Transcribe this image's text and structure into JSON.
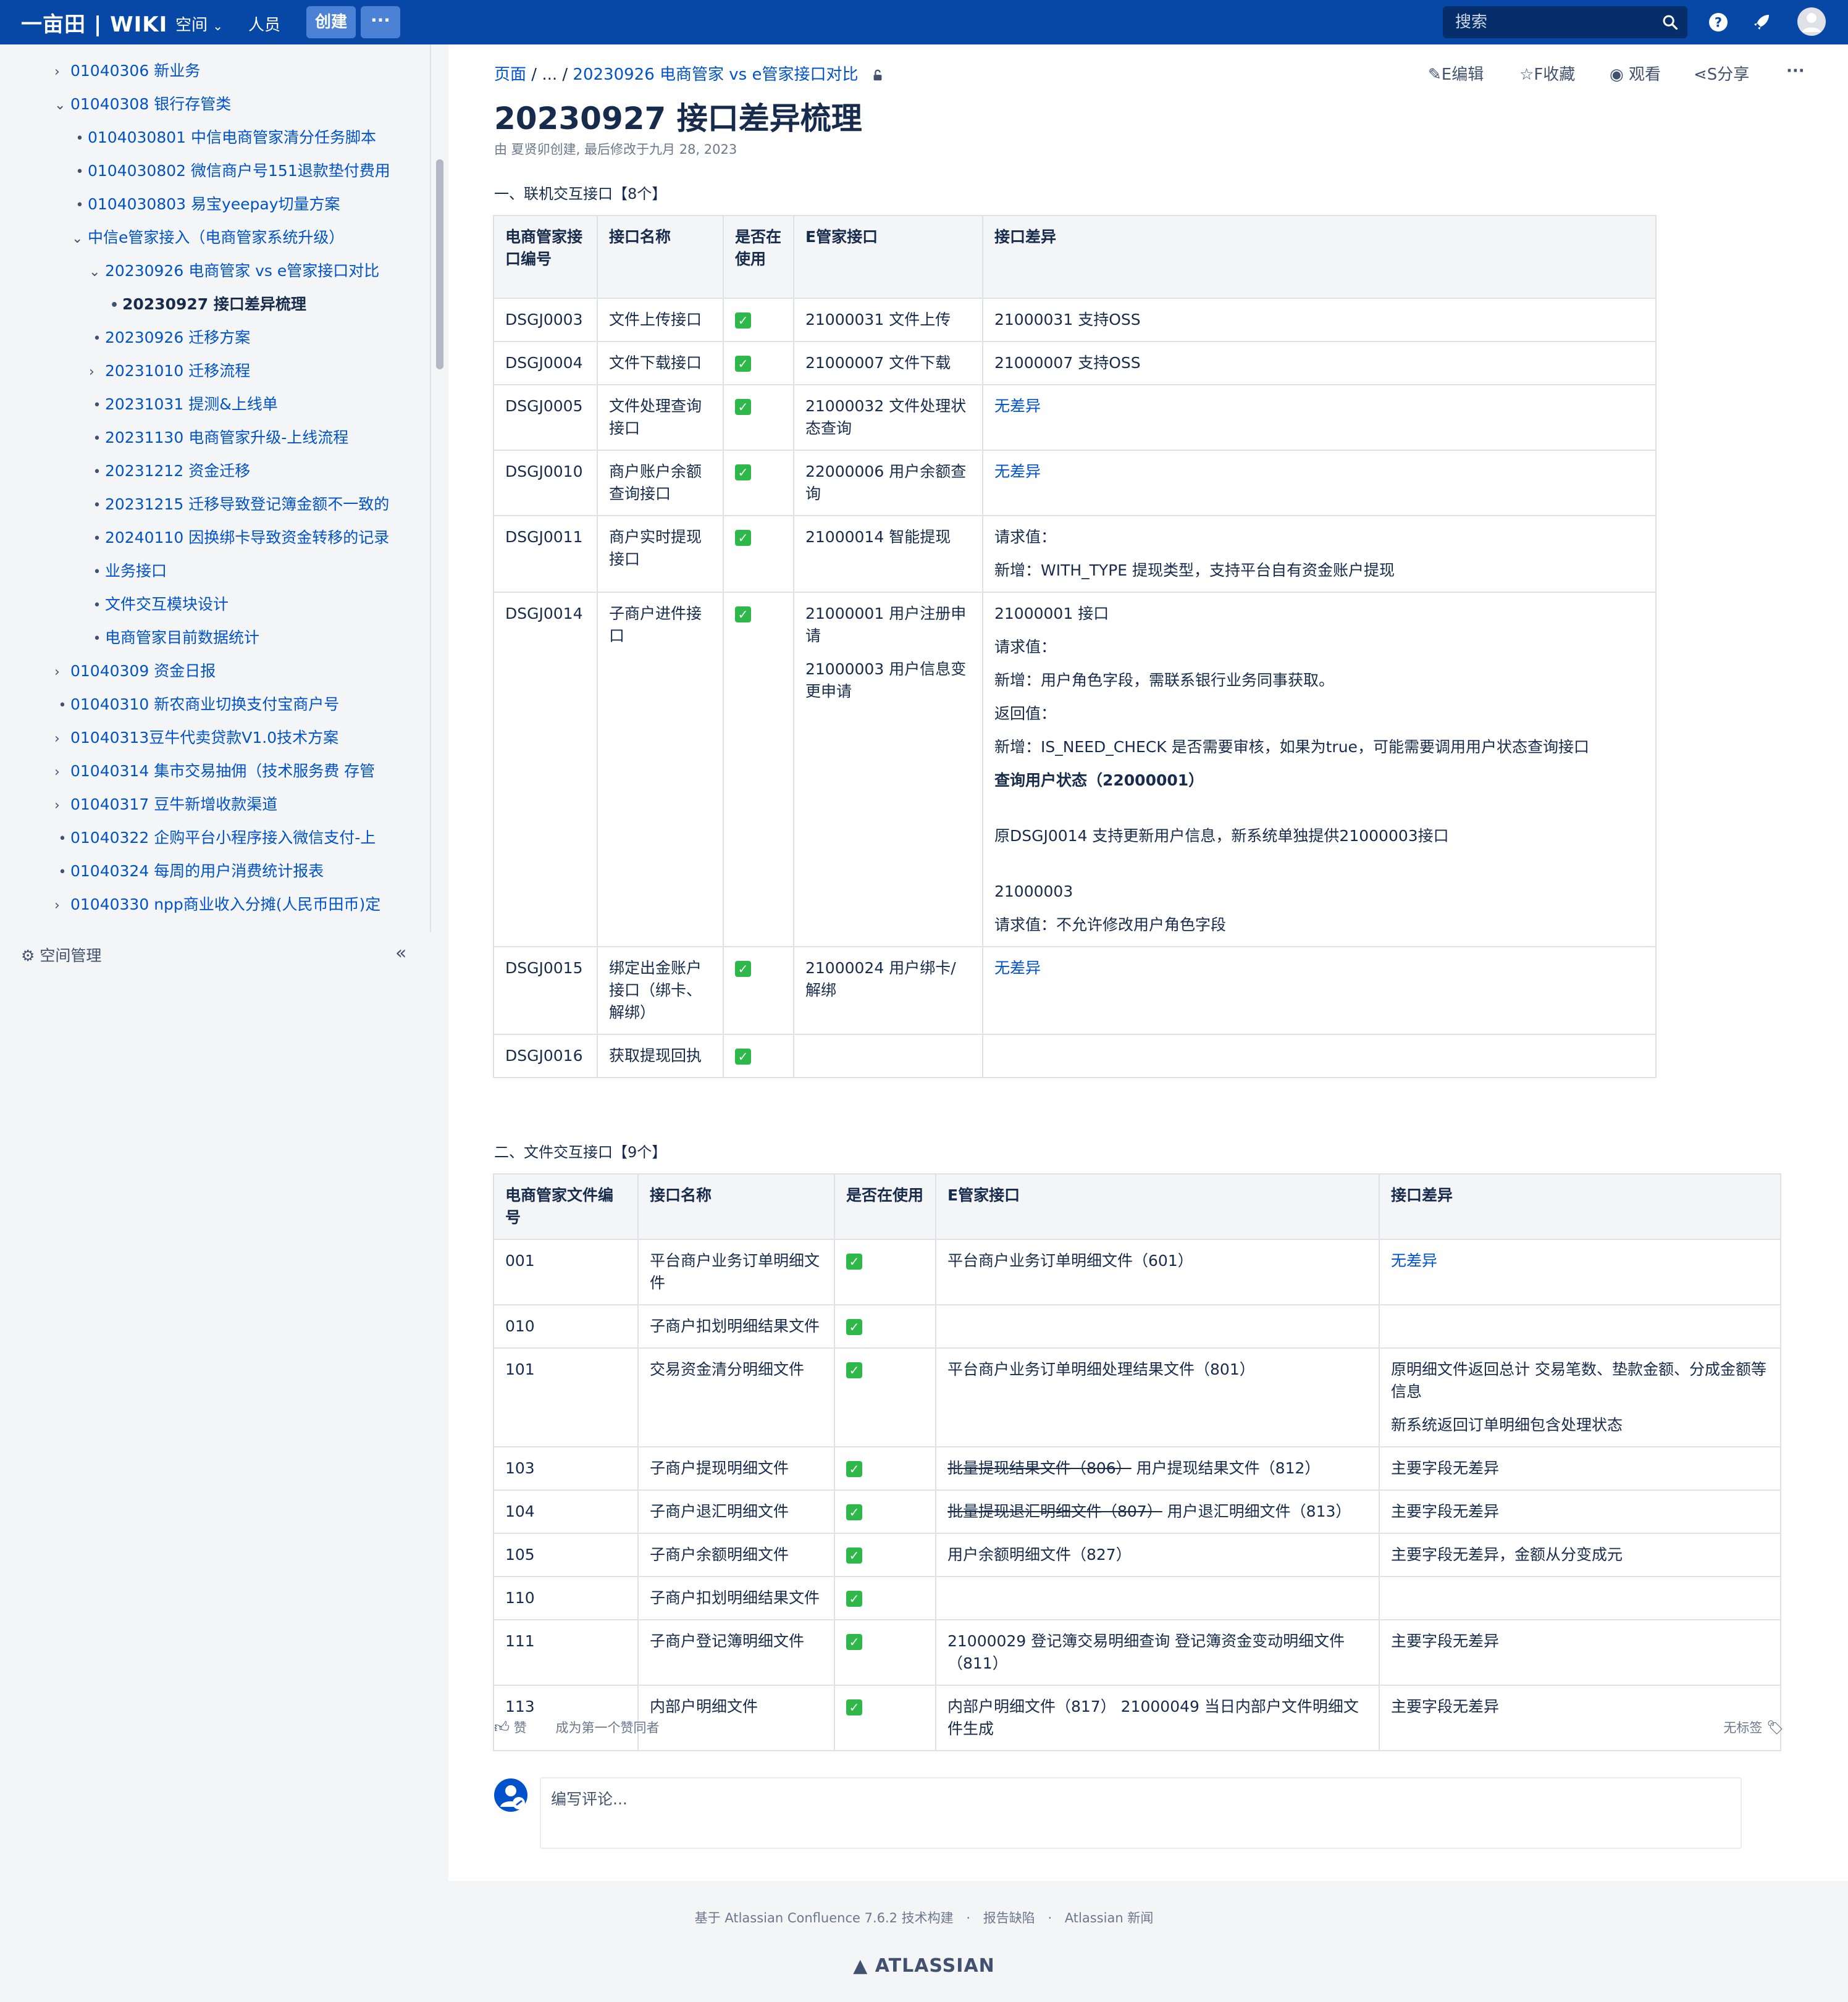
{
  "header": {
    "logo": "一亩田 | WIKI",
    "nav_space": "空间",
    "nav_people": "人员",
    "create_label": "创建",
    "more_label": "···",
    "search_placeholder": "搜索",
    "brand_color": "#0747a6"
  },
  "sidebar": {
    "items": [
      {
        "label": "01040306 新业务",
        "indent": 1,
        "expandable": true
      },
      {
        "label": "01040308 银行存管类",
        "indent": 1,
        "expandable": true,
        "expanded": true
      },
      {
        "label": "0104030801 中信电商管家清分任务脚本",
        "indent": 2,
        "expandable": false
      },
      {
        "label": "0104030802 微信商户号151退款垫付费用",
        "indent": 2,
        "expandable": false
      },
      {
        "label": "0104030803 易宝yeepay切量方案",
        "indent": 2,
        "expandable": false
      },
      {
        "label": "中信e管家接入（电商管家系统升级）",
        "indent": 2,
        "expandable": true,
        "expanded": true
      },
      {
        "label": "20230926 电商管家 vs e管家接口对比",
        "indent": 3,
        "expandable": true,
        "expanded": true
      },
      {
        "label": "20230927 接口差异梳理",
        "indent": 4,
        "expandable": false,
        "current": true
      },
      {
        "label": "20230926 迁移方案",
        "indent": 3,
        "expandable": false
      },
      {
        "label": "20231010 迁移流程",
        "indent": 3,
        "expandable": true
      },
      {
        "label": "20231031 提测&上线单",
        "indent": 3,
        "expandable": false
      },
      {
        "label": "20231130 电商管家升级-上线流程",
        "indent": 3,
        "expandable": false
      },
      {
        "label": "20231212 资金迁移",
        "indent": 3,
        "expandable": false
      },
      {
        "label": "20231215 迁移导致登记簿金额不一致的",
        "indent": 3,
        "expandable": false
      },
      {
        "label": "20240110 因换绑卡导致资金转移的记录",
        "indent": 3,
        "expandable": false
      },
      {
        "label": "业务接口",
        "indent": 3,
        "expandable": false
      },
      {
        "label": "文件交互模块设计",
        "indent": 3,
        "expandable": false
      },
      {
        "label": "电商管家目前数据统计",
        "indent": 3,
        "expandable": false
      },
      {
        "label": "01040309 资金日报",
        "indent": 1,
        "expandable": true
      },
      {
        "label": "01040310 新农商业切换支付宝商户号",
        "indent": 1,
        "expandable": false
      },
      {
        "label": "01040313豆牛代卖贷款V1.0技术方案",
        "indent": 1,
        "expandable": true
      },
      {
        "label": "01040314 集市交易抽佣（技术服务费 存管",
        "indent": 1,
        "expandable": true
      },
      {
        "label": "01040317 豆牛新增收款渠道",
        "indent": 1,
        "expandable": true
      },
      {
        "label": "01040322 企购平台小程序接入微信支付-上",
        "indent": 1,
        "expandable": false
      },
      {
        "label": "01040324 每周的用户消费统计报表",
        "indent": 1,
        "expandable": false
      },
      {
        "label": "01040330 npp商业收入分摊(人民币田币)定",
        "indent": 1,
        "expandable": true
      }
    ],
    "space_mgmt": "空间管理",
    "collapse_icon": "«"
  },
  "page": {
    "breadcrumb": {
      "root": "页面",
      "sep1": "/",
      "ellipsis": "...",
      "sep2": "/",
      "parent": "20230926 电商管家 vs e管家接口对比"
    },
    "actions": {
      "edit": "E编辑",
      "favorite": "F收藏",
      "watch": "观看",
      "share": "S分享",
      "more": "···"
    },
    "title": "20230927 接口差异梳理",
    "byline": "由 夏贤卯创建, 最后修改于九月 28, 2023",
    "section1": "一、联机交互接口【8个】",
    "section2": "二、文件交互接口【9个】"
  },
  "table1": {
    "headers": [
      "电商管家接口编号",
      "接口名称",
      "是否在使用",
      "E管家接口",
      "接口差异"
    ],
    "rows": [
      {
        "code": "DSGJ0003",
        "name": "文件上传接口",
        "in_use": "✓",
        "egj": [
          "21000031 文件上传"
        ],
        "diff": [
          "21000031 支持OSS"
        ]
      },
      {
        "code": "DSGJ0004",
        "name": "文件下载接口",
        "in_use": "✓",
        "egj": [
          "21000007 文件下载"
        ],
        "diff": [
          "21000007 支持OSS"
        ]
      },
      {
        "code": "DSGJ0005",
        "name": "文件处理查询接口",
        "in_use": "✓",
        "egj": [
          "21000032 文件处理状态查询"
        ],
        "diff": [
          "无差异"
        ]
      },
      {
        "code": "DSGJ0010",
        "name": "商户账户余额查询接口",
        "in_use": "✓",
        "egj": [
          "22000006 用户余额查询"
        ],
        "diff": [
          "无差异"
        ]
      },
      {
        "code": "DSGJ0011",
        "name": "商户实时提现接口",
        "in_use": "✓",
        "egj": [
          "21000014 智能提现"
        ],
        "diff": [
          "请求值：",
          "新增：WITH_TYPE  提现类型，支持平台自有资金账户提现"
        ]
      },
      {
        "code": "DSGJ0014",
        "name": "子商户进件接口",
        "in_use": "✓",
        "egj": [
          "21000001 用户注册申请",
          "21000003 用户信息变更申请"
        ],
        "diff": [
          "21000001 接口",
          "请求值：",
          "新增：用户角色字段，需联系银行业务同事获取。",
          "返回值：",
          "新增：IS_NEED_CHECK 是否需要审核，如果为true，可能需要调用用户状态查询接口",
          "查询用户状态（22000001）",
          "原DSGJ0014 支持更新用户信息，新系统单独提供21000003接口",
          "21000003",
          "请求值：不允许修改用户角色字段"
        ]
      },
      {
        "code": "DSGJ0015",
        "name": "绑定出金账户接口（绑卡、解绑）",
        "in_use": "✓",
        "egj": [
          "21000024 用户绑卡/解绑"
        ],
        "diff": [
          "无差异"
        ]
      },
      {
        "code": "DSGJ0016",
        "name": "获取提现回执",
        "in_use": "✓",
        "egj": [
          ""
        ],
        "diff": [
          ""
        ]
      }
    ]
  },
  "table2": {
    "headers": [
      "电商管家文件编号",
      "接口名称",
      "是否在使用",
      "E管家接口",
      "接口差异"
    ],
    "rows": [
      {
        "code": "001",
        "name": "平台商户业务订单明细文件",
        "in_use": "✓",
        "egj_strike": "",
        "egj": "平台商户业务订单明细文件（601）",
        "diff": [
          "无差异"
        ]
      },
      {
        "code": "010",
        "name": "子商户扣划明细结果文件",
        "in_use": "✓",
        "egj_strike": "",
        "egj": "",
        "diff": [
          ""
        ]
      },
      {
        "code": "101",
        "name": "交易资金清分明细文件",
        "in_use": "✓",
        "egj_strike": "",
        "egj": "平台商户业务订单明细处理结果文件（801）",
        "diff": [
          "原明细文件返回总计 交易笔数、垫款金额、分成金额等信息",
          "新系统返回订单明细包含处理状态"
        ]
      },
      {
        "code": "103",
        "name": "子商户提现明细文件",
        "in_use": "✓",
        "egj_strike": "批量提现结果文件（806）",
        "egj": " 用户提现结果文件（812）",
        "diff": [
          "主要字段无差异"
        ]
      },
      {
        "code": "104",
        "name": "子商户退汇明细文件",
        "in_use": "✓",
        "egj_strike": "批量提现退汇明细文件（807）",
        "egj": " 用户退汇明细文件（813）",
        "diff": [
          "主要字段无差异"
        ]
      },
      {
        "code": "105",
        "name": "子商户余额明细文件",
        "in_use": "✓",
        "egj_strike": "",
        "egj": "用户余额明细文件（827）",
        "diff": [
          "主要字段无差异，金额从分变成元"
        ]
      },
      {
        "code": "110",
        "name": "子商户扣划明细结果文件",
        "in_use": "✓",
        "egj_strike": "",
        "egj": "",
        "diff": [
          ""
        ]
      },
      {
        "code": "111",
        "name": "子商户登记簿明细文件",
        "in_use": "✓",
        "egj_strike": "",
        "egj": "21000029 登记簿交易明细查询 登记簿资金变动明细文件（811）",
        "diff": [
          "主要字段无差异"
        ]
      },
      {
        "code": "113",
        "name": "内部户明细文件",
        "in_use": "✓",
        "egj_strike": "",
        "egj": "内部户明细文件（817）  21000049 当日内部户文件明细文件生成",
        "diff": [
          "主要字段无差异"
        ]
      }
    ]
  },
  "likes": {
    "like_label": "赞",
    "first_like": "成为第一个赞同者",
    "no_label": "无标签"
  },
  "comment": {
    "placeholder": "编写评论..."
  },
  "footer": {
    "powered": "基于 Atlassian Confluence 7.6.2 技术构建",
    "dot1": "·",
    "report": "报告缺陷",
    "dot2": "·",
    "news": "Atlassian 新闻",
    "brand": "ATLASSIAN"
  }
}
